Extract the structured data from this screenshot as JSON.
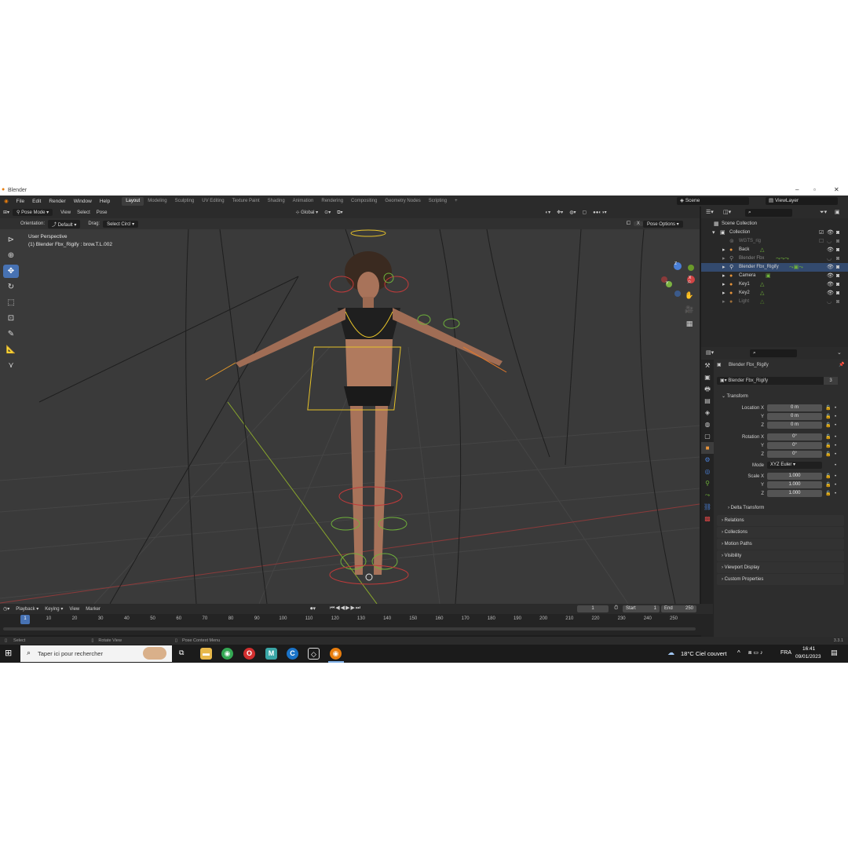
{
  "window": {
    "title": "Blender"
  },
  "menu": {
    "items": [
      "File",
      "Edit",
      "Render",
      "Window",
      "Help"
    ]
  },
  "workspaces": [
    "Layout",
    "Modeling",
    "Sculpting",
    "UV Editing",
    "Texture Paint",
    "Shading",
    "Animation",
    "Rendering",
    "Compositing",
    "Geometry Nodes",
    "Scripting"
  ],
  "active_workspace": "Layout",
  "scene": {
    "label": "Scene",
    "view_layer": "ViewLayer"
  },
  "viewport_header": {
    "mode": "Pose Mode",
    "menus": [
      "View",
      "Select",
      "Pose"
    ],
    "transform_space": "Global",
    "orientation_label": "Orientation:",
    "orientation_value": "Default",
    "drag_label": "Drag:",
    "drag_value": "Select Circl",
    "pose_options": "Pose Options",
    "x_label": "X"
  },
  "viewport_overlay": {
    "line1": "User Perspective",
    "line2": "(1) Blender Fbx_Rigify : brow.T.L.002"
  },
  "gizmo": {
    "x": "X",
    "y": "Y",
    "z": "Z"
  },
  "outliner": {
    "root": "Scene Collection",
    "collection": "Collection",
    "items": [
      "WGTS_rig",
      "Back",
      "Blender Fbx",
      "Blender Fbx_Rigify",
      "Camera",
      "Key1",
      "Key2",
      "Light"
    ]
  },
  "properties": {
    "object_name": "Blender Fbx_Rigify",
    "data_name": "Blender Fbx_Rigify",
    "users": "3",
    "transform_title": "Transform",
    "location_label": "Location X",
    "location": [
      "0 m",
      "0 m",
      "0 m"
    ],
    "rotation_label": "Rotation X",
    "rotation": [
      "0°",
      "0°",
      "0°"
    ],
    "mode_label": "Mode",
    "mode_value": "XYZ Euler",
    "scale_label": "Scale X",
    "scale": [
      "1.000",
      "1.000",
      "1.000"
    ],
    "axis_y": "Y",
    "axis_z": "Z",
    "delta_transform": "Delta Transform",
    "panels": [
      "Relations",
      "Collections",
      "Motion Paths",
      "Visibility",
      "Viewport Display",
      "Custom Properties"
    ]
  },
  "timeline": {
    "menus": [
      "Playback",
      "Keying",
      "View",
      "Marker"
    ],
    "current_frame": "1",
    "start_label": "Start",
    "start": "1",
    "end_label": "End",
    "end": "250",
    "ticks": [
      "1",
      "10",
      "20",
      "30",
      "40",
      "50",
      "60",
      "70",
      "80",
      "90",
      "100",
      "110",
      "120",
      "130",
      "140",
      "150",
      "160",
      "170",
      "180",
      "190",
      "200",
      "210",
      "220",
      "230",
      "240",
      "250"
    ]
  },
  "statusbar": {
    "select": "Select",
    "rotate": "Rotate View",
    "context": "Pose Context Menu",
    "version": "3.3.1"
  },
  "taskbar": {
    "search_placeholder": "Taper ici pour rechercher",
    "weather": "18°C Ciel couvert",
    "language": "FRA",
    "time": "16:41",
    "date": "09/01/2023"
  },
  "colors": {
    "accent": "#4772b3",
    "viewport_bg": "#3a3a3a",
    "panel_bg": "#2d2d2d"
  }
}
